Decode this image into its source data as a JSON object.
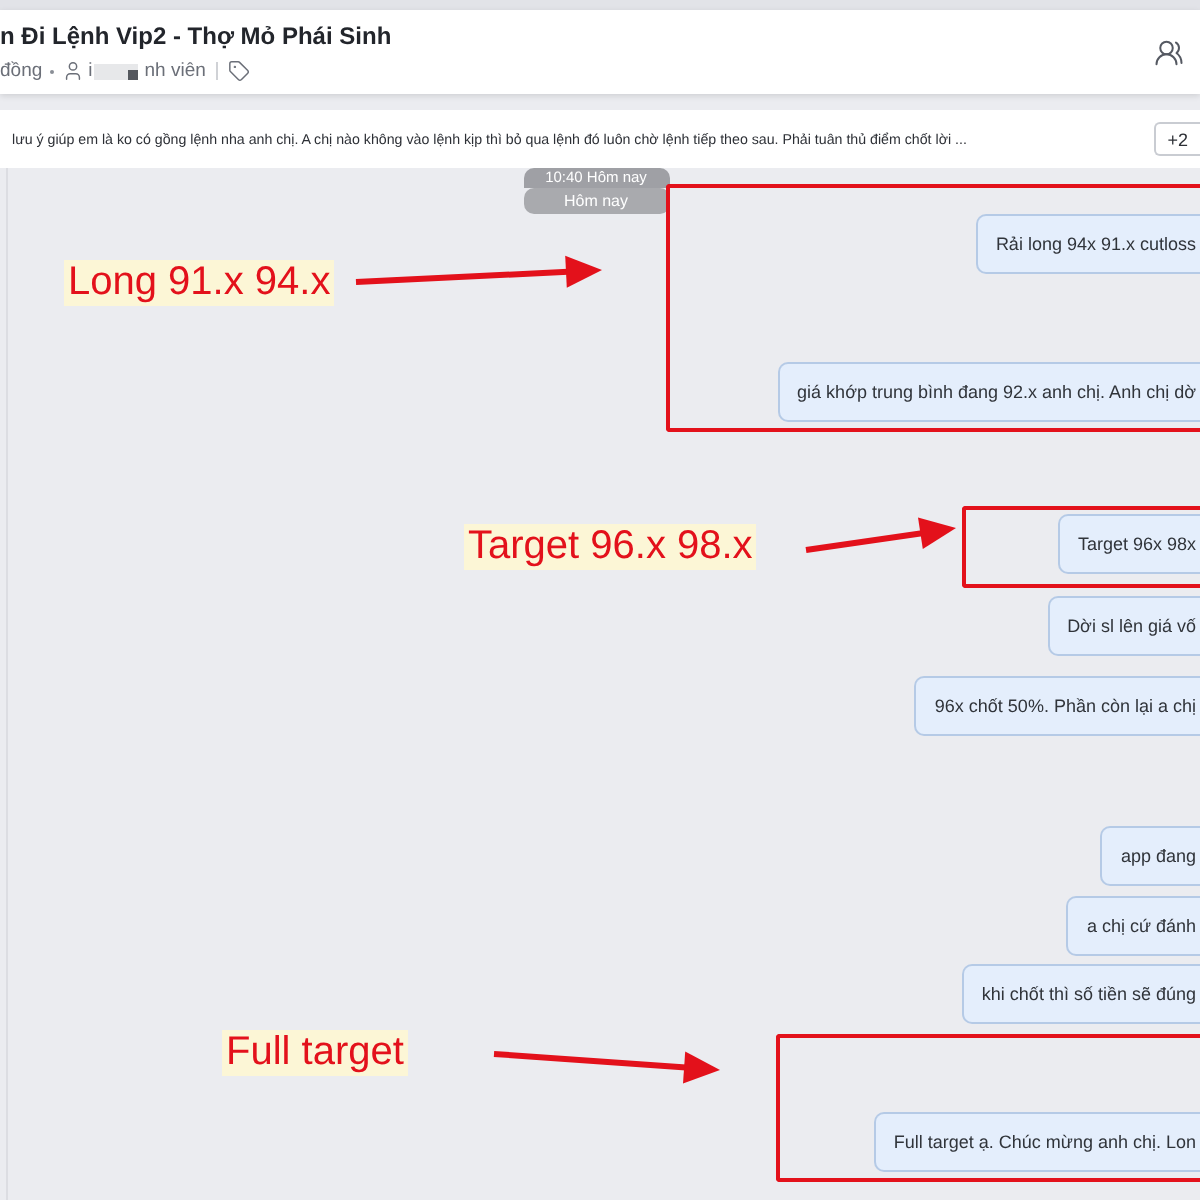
{
  "header": {
    "title": "n Đi Lệnh Vip2 - Thợ Mỏ Phái Sinh",
    "subtitle": "đồng",
    "member_start": "i",
    "member_end": "nh viên"
  },
  "pinned": {
    "text": "lưu ý giúp em là ko có gồng lệnh nha anh chị. A chị nào không vào lệnh kịp thì bỏ qua lệnh đó luôn chờ lệnh tiếp theo sau. Phải tuân thủ điểm chốt lời ...",
    "more_button": "+2"
  },
  "time_badges": [
    "10:40 Hôm nay",
    "Hôm nay"
  ],
  "messages": [
    {
      "text": "Rải long 94x 91.x cutloss"
    },
    {
      "text": "giá khớp trung bình đang 92.x anh chị. Anh chị dờ"
    },
    {
      "text": "Target 96x 98x"
    },
    {
      "text": "Dời sl lên giá vố"
    },
    {
      "text": "96x chốt 50%. Phần còn lại a chị"
    },
    {
      "text": "app đang"
    },
    {
      "text": "a chị cứ đánh"
    },
    {
      "text": "khi chốt thì số tiền sẽ đúng"
    },
    {
      "text": "Full target ạ. Chúc mừng anh chị. Lon"
    }
  ],
  "annotations": [
    {
      "label": "Long 91.x 94.x"
    },
    {
      "label": "Target 96.x 98.x"
    },
    {
      "label": "Full target"
    }
  ]
}
